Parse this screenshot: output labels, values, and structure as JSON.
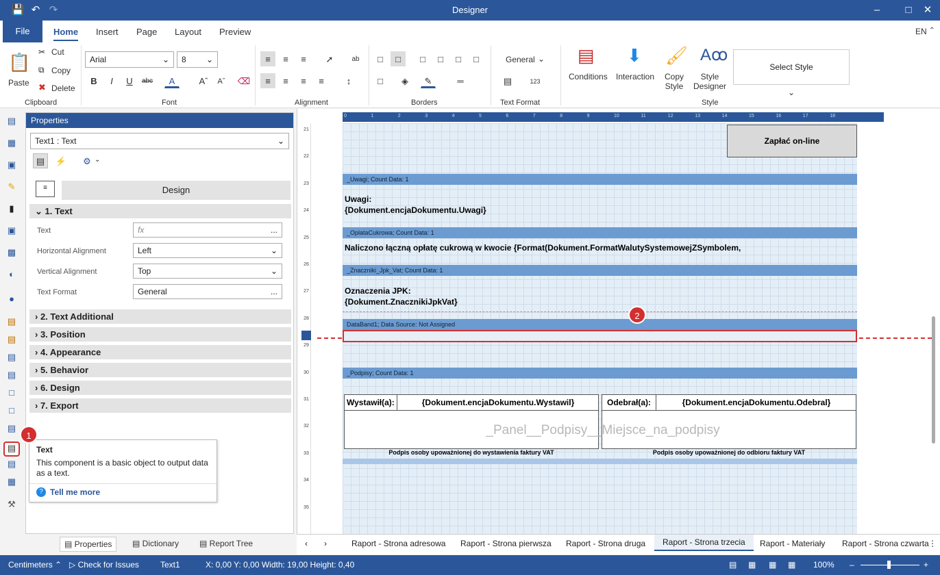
{
  "window": {
    "title": "Designer"
  },
  "menu": {
    "file": "File",
    "tabs": [
      "Home",
      "Insert",
      "Page",
      "Layout",
      "Preview"
    ],
    "lang": "EN"
  },
  "ribbon": {
    "clipboard": {
      "paste": "Paste",
      "cut": "Cut",
      "copy": "Copy",
      "delete": "Delete",
      "group": "Clipboard"
    },
    "font": {
      "family": "Arial",
      "size": "8",
      "group": "Font"
    },
    "alignment": {
      "group": "Alignment"
    },
    "borders": {
      "group": "Borders"
    },
    "textformat": {
      "value": "General",
      "group": "Text Format"
    },
    "style": {
      "conditions": "Conditions",
      "interaction": "Interaction",
      "copy_style": "Copy Style",
      "style_designer": "Style Designer",
      "select_style": "Select Style",
      "group": "Style"
    }
  },
  "properties": {
    "header": "Properties",
    "selector": "Text1 : Text",
    "design_button": "Design",
    "section_text": "1. Text",
    "rows": [
      {
        "label": "Text",
        "value": "fx"
      },
      {
        "label": "Horizontal Alignment",
        "value": "Left"
      },
      {
        "label": "Vertical Alignment",
        "value": "Top"
      },
      {
        "label": "Text Format",
        "value": "General"
      }
    ],
    "sections": [
      "2. Text Additional",
      "3. Position",
      "4. Appearance",
      "5. Behavior",
      "6. Design",
      "7. Export"
    ]
  },
  "bottom_tabs": [
    "Properties",
    "Dictionary",
    "Report Tree"
  ],
  "tooltip": {
    "title": "Text",
    "body": "This component is a basic object to output data as a text.",
    "link": "Tell me more"
  },
  "badges": {
    "one": "1",
    "two": "2"
  },
  "report": {
    "pay_button": "Zapłać on-line",
    "band_uwagi": "_Uwagi; Count Data: 1",
    "uwagi_label": "Uwagi:",
    "uwagi_expr": "{Dokument.encjaDokumentu.Uwagi}",
    "band_oplata": "_OplataCukrowa; Count Data: 1",
    "oplata_text": "Naliczono łączną opłatę cukrową w kwocie {Format(Dokument.FormatWalutySystemowejZSymbolem,",
    "band_jpk": "_Znaczniki_Jpk_Vat; Count Data: 1",
    "jpk_label": "Oznaczenia JPK:",
    "jpk_expr": "{Dokument.ZnacznikiJpkVat}",
    "band_data": "DataBand1; Data Source: Not Assigned",
    "band_podpisy": "_Podpisy; Count Data: 1",
    "wystawil_label": "Wystawił(a):",
    "wystawil_expr": "{Dokument.encjaDokumentu.Wystawil}",
    "odebral_label": "Odebrał(a):",
    "odebral_expr": "{Dokument.encjaDokumentu.Odebral}",
    "panel_watermark": "_Panel__Podpisy__Miejsce_na_podpisy",
    "sign_left": "Podpis osoby upoważnionej do wystawienia faktury VAT",
    "sign_right": "Podpis osoby upoważnionej do odbioru faktury VAT"
  },
  "ruler_top": [
    "0",
    "1",
    "2",
    "3",
    "4",
    "5",
    "6",
    "7",
    "8",
    "9",
    "10",
    "11",
    "12",
    "13",
    "14",
    "15",
    "16",
    "17",
    "18"
  ],
  "ruler_left": [
    "21",
    "22",
    "23",
    "24",
    "25",
    "26",
    "27",
    "28",
    "29",
    "30",
    "31",
    "32",
    "33",
    "34",
    "35"
  ],
  "page_tabs": [
    "Raport - Strona adresowa",
    "Raport - Strona pierwsza",
    "Raport - Strona druga",
    "Raport - Strona trzecia",
    "Raport - Materiały",
    "Raport - Strona czwarta"
  ],
  "status": {
    "units": "Centimeters",
    "check": "Check for Issues",
    "component": "Text1",
    "coords": "X: 0,00  Y: 0,00  Width: 19,00  Height: 0,40",
    "zoom": "100%"
  }
}
